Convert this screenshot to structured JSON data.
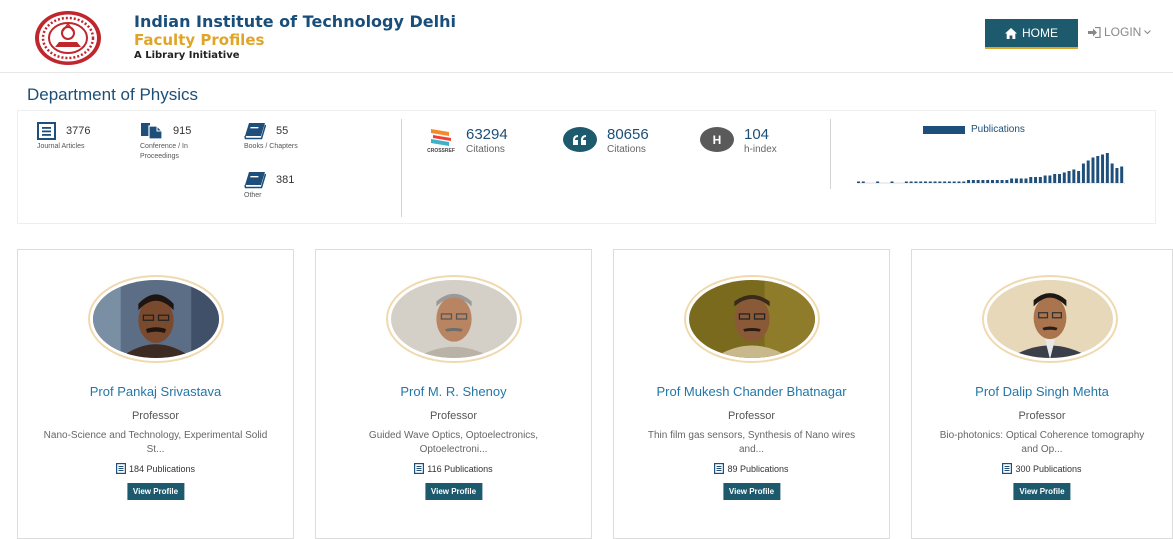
{
  "header": {
    "institute": "Indian Institute of Technology Delhi",
    "portal": "Faculty Profiles",
    "tagline": "A Library Initiative",
    "logo_icon": "iit-delhi-emblem-icon",
    "nav": {
      "home_label": "HOME",
      "home_icon": "home-icon",
      "login_label": "LOGIN",
      "login_icon": "sign-in-icon",
      "accent_color": "#1e5a6e",
      "highlight_color": "#e0a528"
    }
  },
  "department": {
    "title": "Department of Physics"
  },
  "publications": [
    {
      "count": "3776",
      "label": "Journal Articles",
      "icon": "document-icon"
    },
    {
      "count": "915",
      "label": "Conference / In Proceedings",
      "icon": "copy-icon"
    },
    {
      "count": "55",
      "label": "Books / Chapters",
      "icon": "book-icon"
    },
    {
      "count": "381",
      "label": "Other",
      "icon": "book-icon"
    }
  ],
  "citations": [
    {
      "value": "63294",
      "label": "Citations",
      "source": "crossref",
      "source_label": "CROSSREF",
      "icon": "crossref-icon"
    },
    {
      "value": "80656",
      "label": "Citations",
      "icon": "quote-icon",
      "color": "#1e5a6e"
    },
    {
      "value": "104",
      "label": "h-index",
      "icon": "h-index-icon",
      "badge": "H",
      "color": "#5a5a5a"
    }
  ],
  "chart_data": {
    "type": "bar",
    "series": [
      {
        "name": "Publications",
        "color": "#1e4e7a",
        "values": [
          1,
          1,
          0,
          0,
          1,
          0,
          0,
          1,
          0,
          0,
          1,
          1,
          1,
          1,
          1,
          1,
          1,
          1,
          1,
          1,
          1,
          1,
          1,
          2,
          2,
          2,
          2,
          2,
          2,
          2,
          2,
          2,
          3,
          3,
          3,
          3,
          4,
          4,
          4,
          5,
          5,
          6,
          6,
          7,
          8,
          9,
          8,
          13,
          15,
          17,
          18,
          19,
          20,
          13,
          10,
          11
        ]
      }
    ],
    "legend_position": "top",
    "grid": false
  },
  "faculty": [
    {
      "name": "Prof Pankaj Srivastava",
      "designation": "Professor",
      "interests": "Nano-Science and Technology, Experimental Solid St...",
      "publications": "184 Publications",
      "button": "View Profile"
    },
    {
      "name": "Prof M. R. Shenoy",
      "designation": "Professor",
      "interests": "Guided Wave Optics, Optoelectronics, Optoelectroni...",
      "publications": "116 Publications",
      "button": "View Profile"
    },
    {
      "name": "Prof Mukesh Chander Bhatnagar",
      "designation": "Professor",
      "interests": "Thin film gas sensors, Synthesis of Nano wires and...",
      "publications": "89 Publications",
      "button": "View Profile"
    },
    {
      "name": "Prof Dalip Singh Mehta",
      "designation": "Professor",
      "interests": "Bio-photonics: Optical Coherence tomography and Op...",
      "publications": "300 Publications",
      "button": "View Profile"
    }
  ]
}
